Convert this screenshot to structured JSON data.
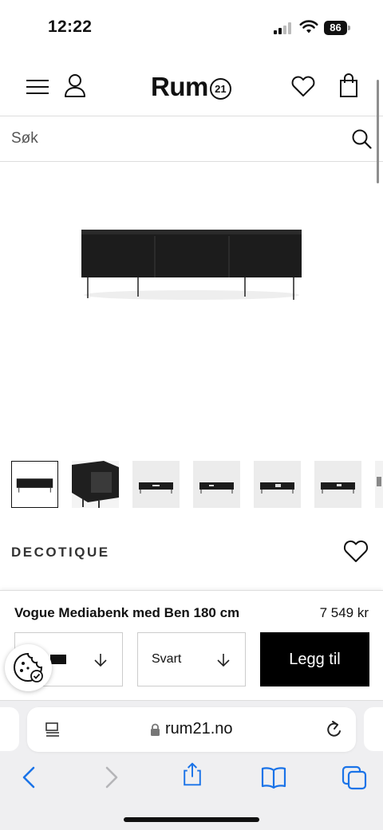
{
  "status_bar": {
    "time": "12:22",
    "battery": "86"
  },
  "header": {
    "logo_text": "Rum",
    "logo_badge": "21"
  },
  "search": {
    "placeholder": "Søk"
  },
  "product": {
    "brand": "DECOTIQUE",
    "name": "Vogue Mediabenk med Ben 180 cm",
    "price": "7 549 kr",
    "color_option": "Svart",
    "add_to_cart_label": "Legg til",
    "thumbnails": [
      "front-black",
      "side-open",
      "front-white-bg",
      "front-white-bg",
      "front-white-bg",
      "front-white-bg",
      "partial"
    ]
  },
  "browser": {
    "url": "rum21.no"
  },
  "colors": {
    "accent": "#000000",
    "ios_blue": "#1a73e8"
  },
  "icons": [
    "menu-icon",
    "user-icon",
    "heart-icon",
    "bag-icon",
    "search-icon",
    "chevron-down-icon",
    "cookie-icon",
    "reader-icon",
    "lock-icon",
    "reload-icon",
    "back-icon",
    "forward-icon",
    "share-icon",
    "bookmarks-icon",
    "tabs-icon"
  ]
}
